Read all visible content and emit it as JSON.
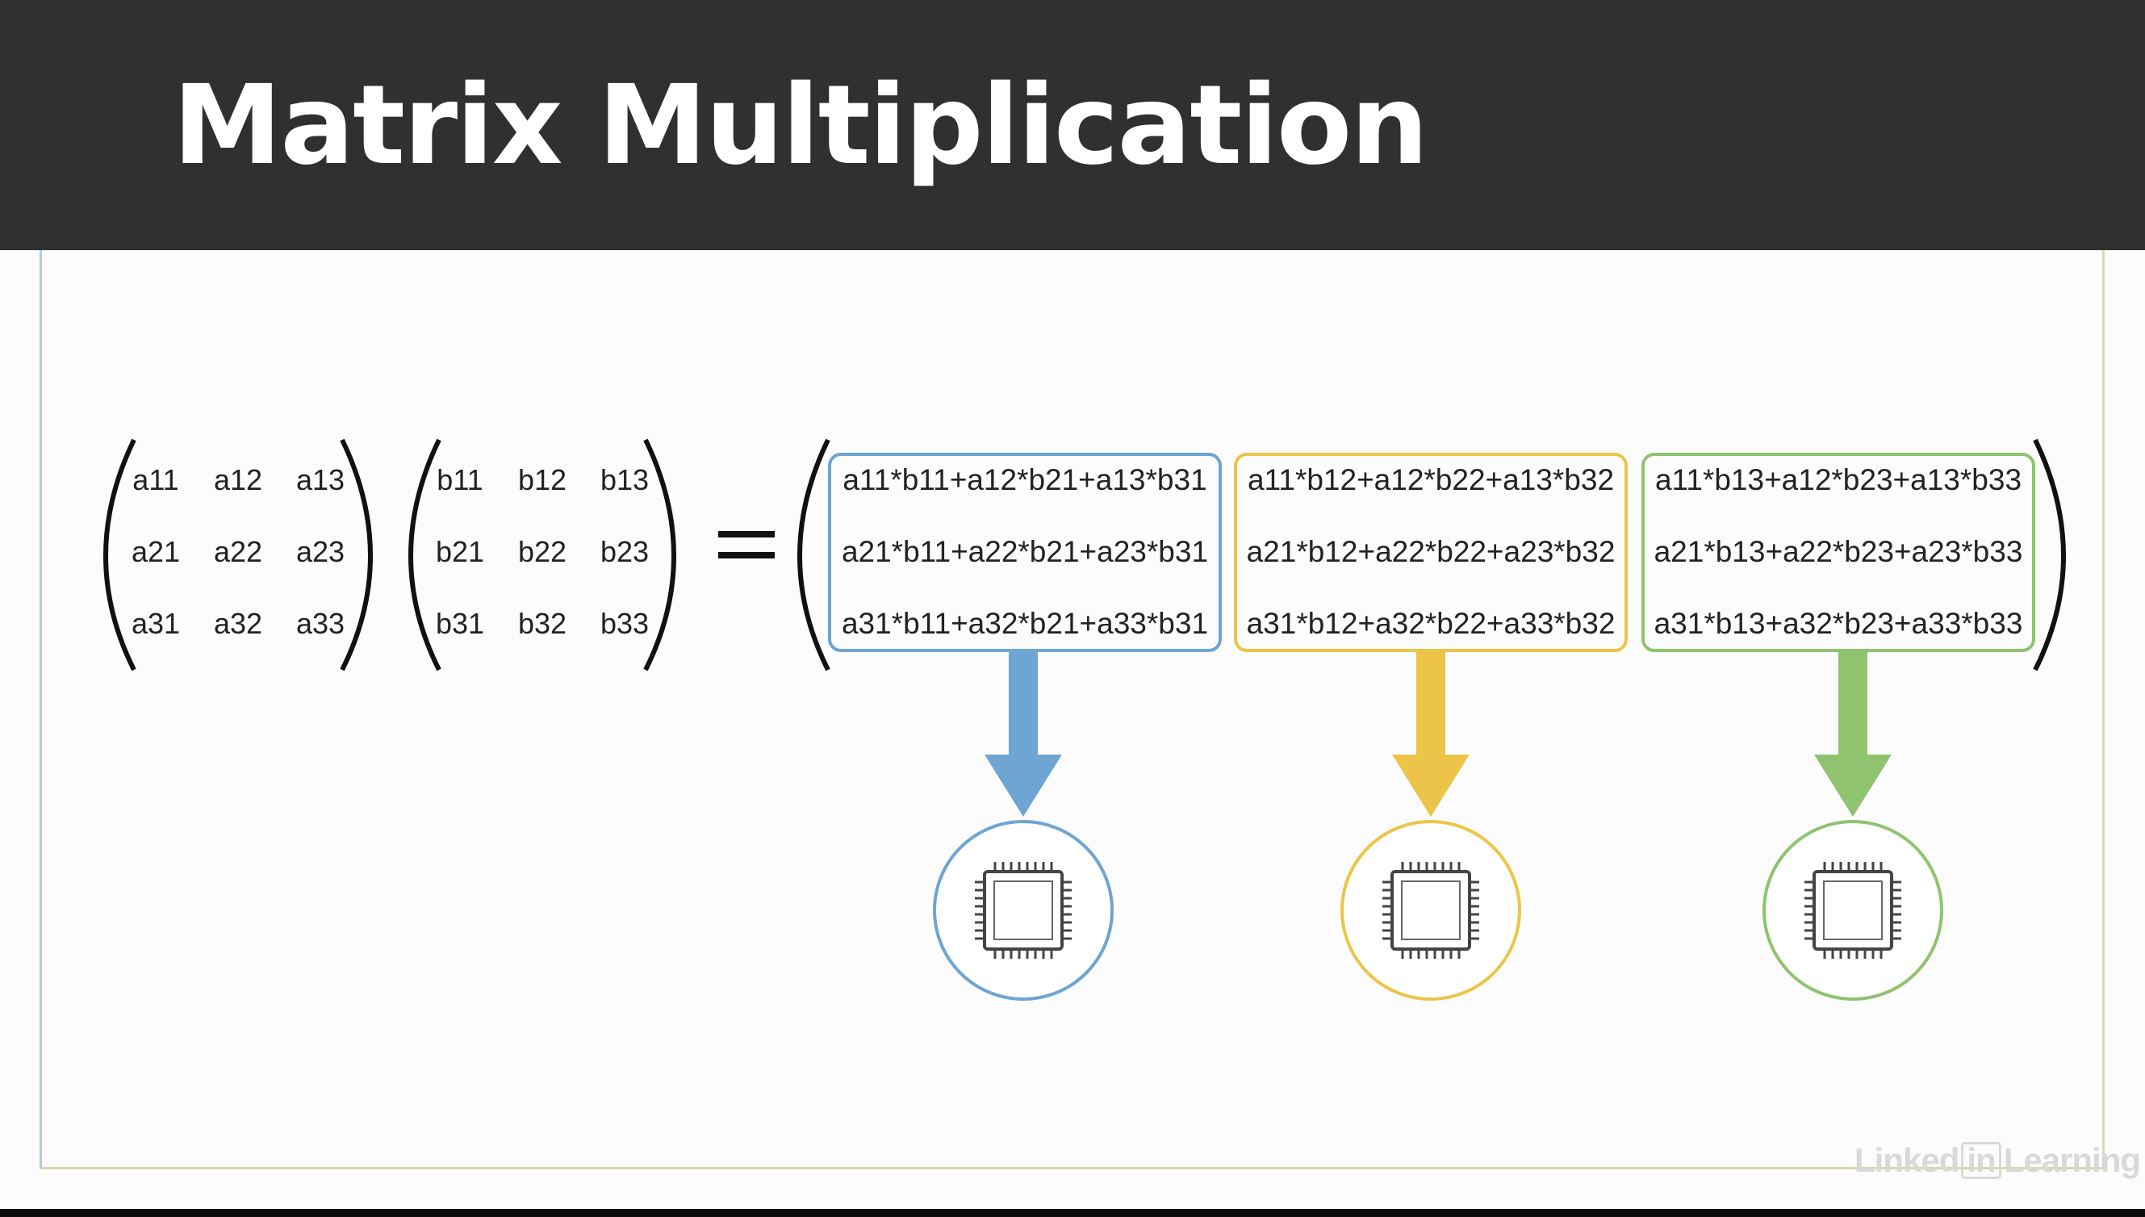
{
  "title": "Matrix Multiplication",
  "matrix_a": [
    [
      "a11",
      "a12",
      "a13"
    ],
    [
      "a21",
      "a22",
      "a23"
    ],
    [
      "a31",
      "a32",
      "a33"
    ]
  ],
  "matrix_b": [
    [
      "b11",
      "b12",
      "b13"
    ],
    [
      "b21",
      "b22",
      "b23"
    ],
    [
      "b31",
      "b32",
      "b33"
    ]
  ],
  "equals": "=",
  "columns": [
    {
      "color": "#6ea5d2",
      "rows": [
        "a11*b11+a12*b21+a13*b31",
        "a21*b11+a22*b21+a23*b31",
        "a31*b11+a32*b21+a33*b31"
      ],
      "icon": "cpu-chip-icon"
    },
    {
      "color": "#ecc548",
      "rows": [
        "a11*b12+a12*b22+a13*b32",
        "a21*b12+a22*b22+a23*b32",
        "a31*b12+a32*b22+a33*b32"
      ],
      "icon": "cpu-chip-icon"
    },
    {
      "color": "#8fc370",
      "rows": [
        "a11*b13+a12*b23+a13*b33",
        "a21*b13+a22*b23+a23*b33",
        "a31*b13+a32*b23+a33*b33"
      ],
      "icon": "cpu-chip-icon"
    }
  ],
  "watermark": {
    "prefix": "Linked",
    "badge": "in",
    "suffix": "Learning"
  }
}
